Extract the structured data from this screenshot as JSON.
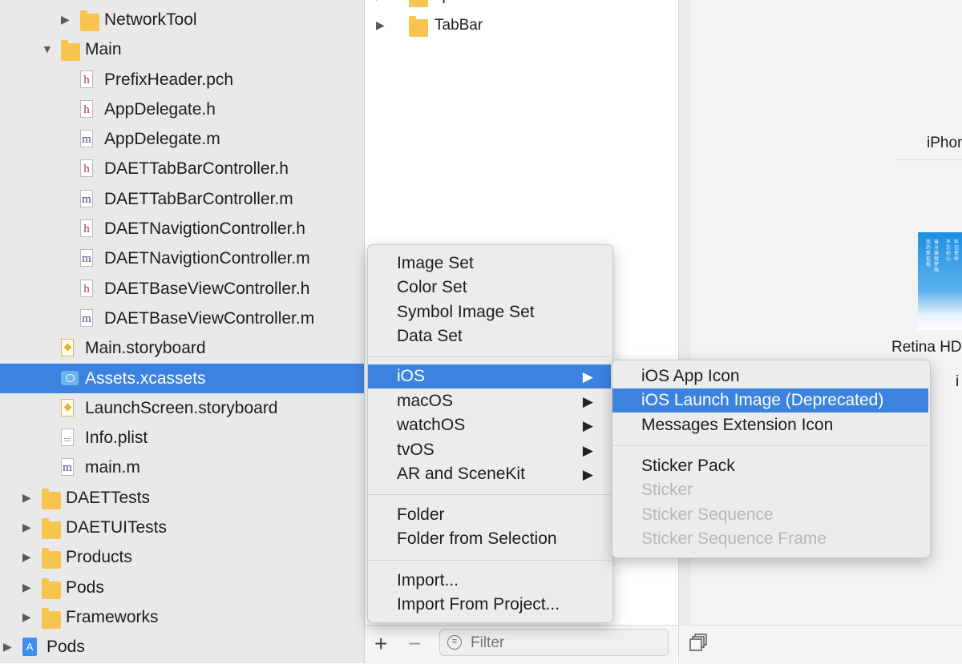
{
  "navigator": {
    "items": [
      {
        "label": "NetworkTool",
        "kind": "folder",
        "indent": 2,
        "disclosure": "closed"
      },
      {
        "label": "Main",
        "kind": "folder",
        "indent": 1,
        "disclosure": "open"
      },
      {
        "label": "PrefixHeader.pch",
        "kind": "h",
        "indent": 2
      },
      {
        "label": "AppDelegate.h",
        "kind": "h",
        "indent": 2
      },
      {
        "label": "AppDelegate.m",
        "kind": "m",
        "indent": 2
      },
      {
        "label": "DAETTabBarController.h",
        "kind": "h",
        "indent": 2
      },
      {
        "label": "DAETTabBarController.m",
        "kind": "m",
        "indent": 2
      },
      {
        "label": "DAETNavigtionController.h",
        "kind": "h",
        "indent": 2
      },
      {
        "label": "DAETNavigtionController.m",
        "kind": "m",
        "indent": 2
      },
      {
        "label": "DAETBaseViewController.h",
        "kind": "h",
        "indent": 2
      },
      {
        "label": "DAETBaseViewController.m",
        "kind": "m",
        "indent": 2
      },
      {
        "label": "Main.storyboard",
        "kind": "storyboard",
        "indent": 1
      },
      {
        "label": "Assets.xcassets",
        "kind": "xcassets",
        "indent": 1,
        "selected": true
      },
      {
        "label": "LaunchScreen.storyboard",
        "kind": "storyboard",
        "indent": 1
      },
      {
        "label": "Info.plist",
        "kind": "plist",
        "indent": 1
      },
      {
        "label": "main.m",
        "kind": "m",
        "indent": 1
      },
      {
        "label": "DAETTests",
        "kind": "folder",
        "indent": 0,
        "disclosure": "closed"
      },
      {
        "label": "DAETUITests",
        "kind": "folder",
        "indent": 0,
        "disclosure": "closed"
      },
      {
        "label": "Products",
        "kind": "folder",
        "indent": 0,
        "disclosure": "closed"
      },
      {
        "label": "Pods",
        "kind": "folder",
        "indent": 0,
        "disclosure": "closed"
      },
      {
        "label": "Frameworks",
        "kind": "folder",
        "indent": 0,
        "disclosure": "closed"
      },
      {
        "label": "Pods",
        "kind": "project",
        "indent": -1,
        "disclosure": "closed"
      }
    ]
  },
  "assets": {
    "items": [
      {
        "label": "special"
      },
      {
        "label": "TabBar"
      }
    ],
    "add_icon": "+",
    "remove_icon": "−",
    "filter_placeholder": "Filter"
  },
  "preview": {
    "iphone_label": "iPhon",
    "retina_label": "Retina HD",
    "i_label": "i"
  },
  "menu": {
    "items": [
      {
        "label": "Image Set"
      },
      {
        "label": "Color Set"
      },
      {
        "label": "Symbol Image Set"
      },
      {
        "label": "Data Set"
      },
      {
        "separator": true
      },
      {
        "label": "iOS",
        "submenu": true,
        "highlighted": true
      },
      {
        "label": "macOS",
        "submenu": true
      },
      {
        "label": "watchOS",
        "submenu": true
      },
      {
        "label": "tvOS",
        "submenu": true
      },
      {
        "label": "AR and SceneKit",
        "submenu": true
      },
      {
        "separator": true
      },
      {
        "label": "Folder"
      },
      {
        "label": "Folder from Selection"
      },
      {
        "separator": true
      },
      {
        "label": "Import..."
      },
      {
        "label": "Import From Project..."
      }
    ]
  },
  "submenu": {
    "items": [
      {
        "label": "iOS App Icon"
      },
      {
        "label": "iOS Launch Image (Deprecated)",
        "highlighted": true
      },
      {
        "label": "Messages Extension Icon"
      },
      {
        "separator": true
      },
      {
        "label": "Sticker Pack"
      },
      {
        "label": "Sticker",
        "disabled": true
      },
      {
        "label": "Sticker Sequence",
        "disabled": true
      },
      {
        "label": "Sticker Sequence Frame",
        "disabled": true
      }
    ]
  },
  "colors": {
    "selection": "#3c83e0",
    "folder": "#f6c44f",
    "disabled_text": "#b8b8b8"
  }
}
